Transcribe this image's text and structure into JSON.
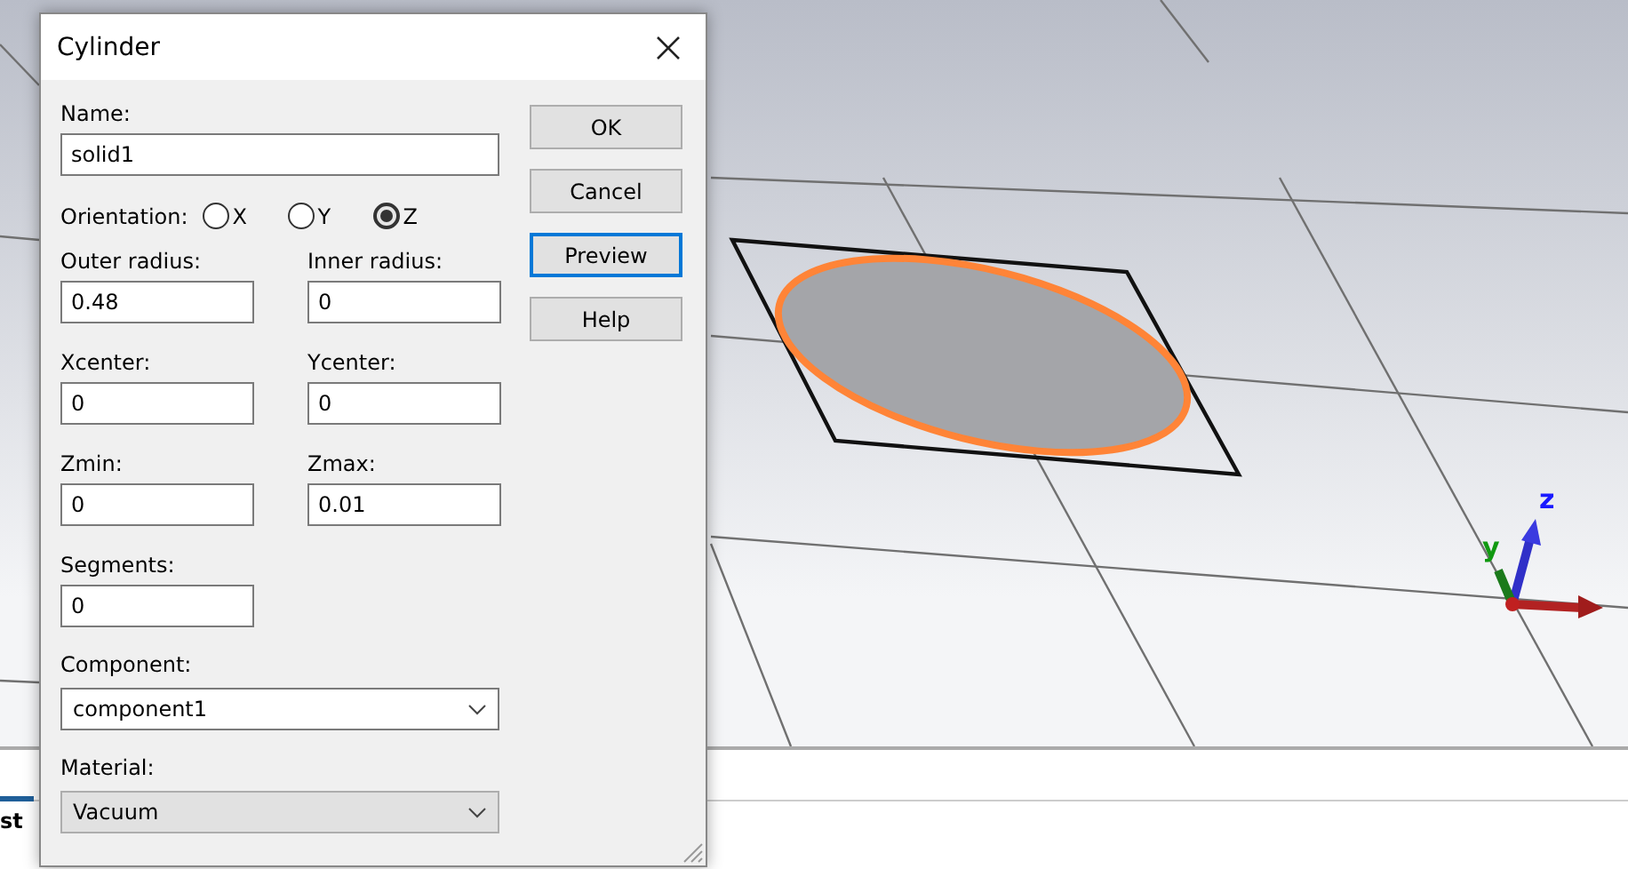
{
  "viewport": {
    "axes": [
      {
        "label": "z",
        "color": "#1a1aff"
      },
      {
        "label": "y",
        "color": "#119911"
      }
    ]
  },
  "bottom_panel": {
    "tab": {
      "label": "st",
      "selected": true
    }
  },
  "dialog": {
    "title": "Cylinder",
    "name_field": {
      "label": "Name:",
      "value": "solid1"
    },
    "orientation": {
      "label": "Orientation:",
      "options": [
        {
          "label": "X",
          "selected": false
        },
        {
          "label": "Y",
          "selected": false
        },
        {
          "label": "Z",
          "selected": true
        }
      ]
    },
    "fields": [
      {
        "label": "Outer radius:",
        "value": "0.48"
      },
      {
        "label": "Inner radius:",
        "value": "0"
      },
      {
        "label": "Xcenter:",
        "value": "0"
      },
      {
        "label": "Ycenter:",
        "value": "0"
      },
      {
        "label": "Zmin:",
        "value": "0"
      },
      {
        "label": "Zmax:",
        "value": "0.01"
      },
      {
        "label": "Segments:",
        "value": "0"
      }
    ],
    "dropdowns": [
      {
        "label": "Component:",
        "value": "component1",
        "disabled": false
      },
      {
        "label": "Material:",
        "value": "Vacuum",
        "disabled": true
      }
    ],
    "buttons": [
      {
        "label": "OK",
        "focused": false
      },
      {
        "label": "Cancel",
        "focused": false
      },
      {
        "label": "Preview",
        "focused": true
      },
      {
        "label": "Help",
        "focused": false
      }
    ]
  }
}
